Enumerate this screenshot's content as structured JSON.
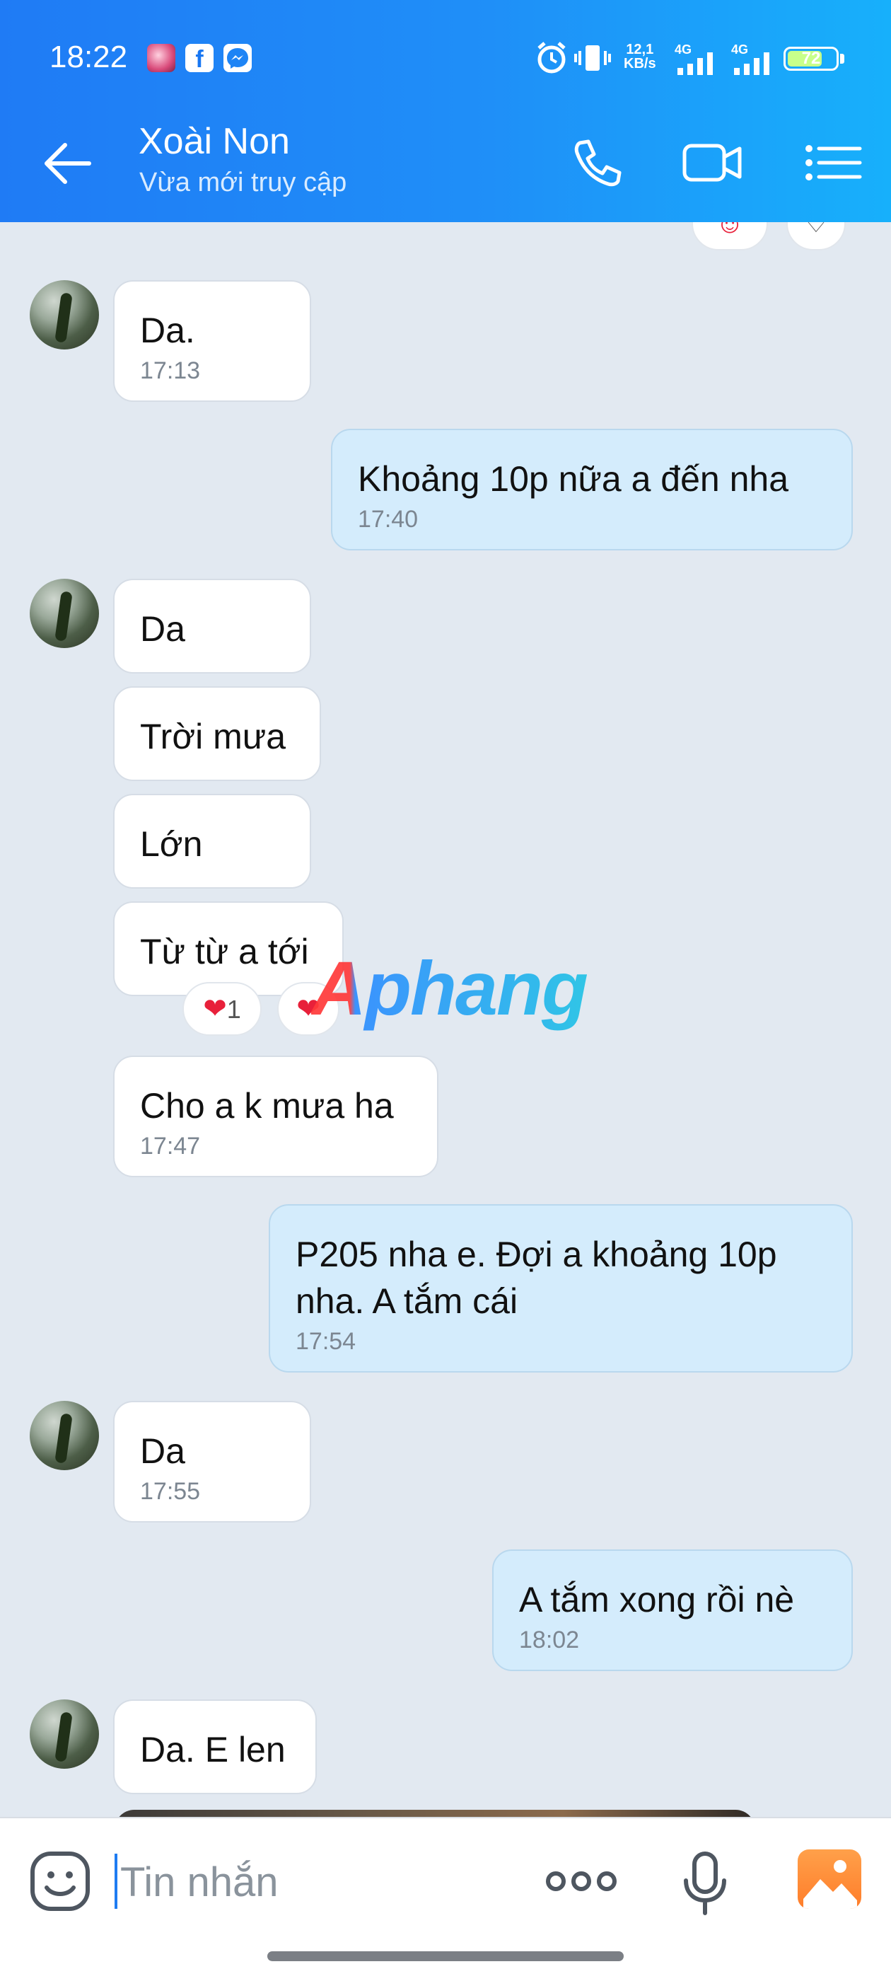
{
  "status_bar": {
    "time": "18:22",
    "network_speed_top": "12,1",
    "network_speed_bottom": "KB/s",
    "sim1": "4G",
    "sim2": "4G",
    "battery": "72",
    "battery_level_percent": 72,
    "icons": [
      "game-app-icon",
      "facebook-icon",
      "messenger-icon",
      "alarm-icon",
      "vibrate-icon",
      "signal-icon",
      "battery-icon"
    ]
  },
  "header": {
    "contact_name": "Xoài Non",
    "contact_status": "Vừa mới truy cập",
    "icons": [
      "back-arrow-icon",
      "phone-icon",
      "video-camera-icon",
      "menu-list-icon"
    ],
    "accent_color": "#1f8ff8"
  },
  "messages": [
    {
      "side": "in",
      "text": "Da.",
      "time": "17:13"
    },
    {
      "side": "out",
      "text": "Khoảng 10p nữa a đến nha",
      "time": "17:40"
    },
    {
      "side": "in",
      "text": "Da",
      "time": ""
    },
    {
      "side": "in",
      "text": "Trời mưa",
      "time": ""
    },
    {
      "side": "in",
      "text": "Lớn",
      "time": ""
    },
    {
      "side": "in",
      "text": "Từ từ a tới",
      "time": "",
      "reaction_count": "1"
    },
    {
      "side": "in",
      "text": "Cho a k mưa ha",
      "time": "17:47"
    },
    {
      "side": "out",
      "text": "P205 nha e. Đợi a khoảng 10p nha. A tắm cái",
      "time": "17:54"
    },
    {
      "side": "in",
      "text": "Da",
      "time": "17:55"
    },
    {
      "side": "out",
      "text": "A tắm xong rồi nè",
      "time": "18:02"
    },
    {
      "side": "in",
      "text": "Da. E len",
      "time": ""
    }
  ],
  "reactions": {
    "heart": "❤",
    "count": "1"
  },
  "watermark": "Aphang",
  "input": {
    "placeholder": "Tin nhắn",
    "icons": [
      "emoji-icon",
      "more-dots-icon",
      "microphone-icon",
      "image-icon"
    ]
  }
}
